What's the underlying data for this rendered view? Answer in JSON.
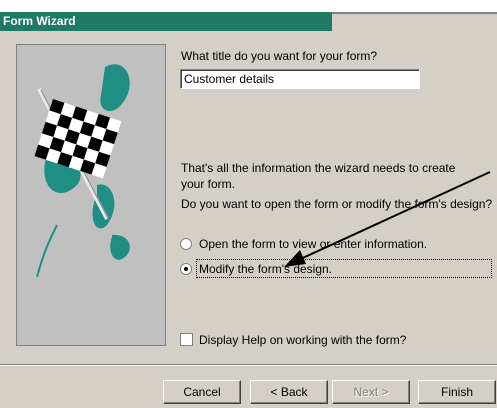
{
  "window": {
    "title": "Form Wizard",
    "accent": "#1e7a63",
    "face": "#d4d0c8"
  },
  "question_title": "What title do you want for your form?",
  "title_value": "Customer details",
  "info_text": "That's all the information the wizard needs to create your form.",
  "question_open": "Do you want to open the form or modify the form's design?",
  "options": [
    {
      "label": "Open the form to view or enter information.",
      "selected": false
    },
    {
      "label": "Modify the form's design.",
      "selected": true
    }
  ],
  "help_checkbox": {
    "label": "Display Help on working with the form?",
    "checked": false
  },
  "buttons": {
    "cancel": "Cancel",
    "back": "< Back",
    "next": "Next >",
    "finish": "Finish"
  },
  "icons": {
    "picture": "checkered-flag-icon",
    "annotation": "arrow-annotation"
  }
}
